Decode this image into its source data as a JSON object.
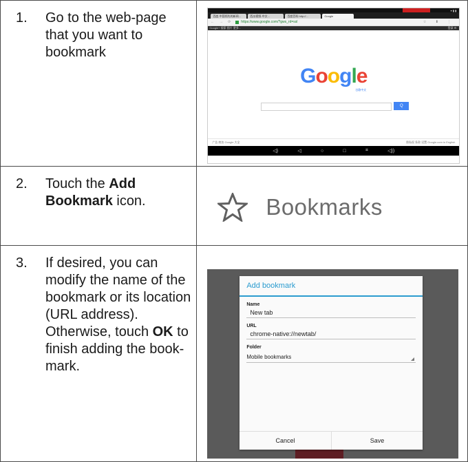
{
  "steps": [
    {
      "number": "1.",
      "text": "Go to the web-page that you want to bookmark"
    },
    {
      "number": "2.",
      "text_before": "Touch the ",
      "bold": "Add Bookmark",
      "text_after": " icon."
    },
    {
      "number": "3.",
      "text_before": "If desired, you can modify the name of the bookmark or its location (URL address). Otherwise, touch ",
      "bold": "OK",
      "text_after": " to finish adding the book-mark."
    }
  ],
  "browser": {
    "tabs": [
      "百度-中国领先的新闻...",
      "西瓜视频-中文...",
      "百度百科 http://...",
      "Google"
    ],
    "url": "https://www.google.com/?gws_rd=ssl",
    "logo_letters": [
      "G",
      "o",
      "o",
      "g",
      "l",
      "e"
    ],
    "logo_sub": "谷歌中文",
    "search_button": "Q",
    "footer_left": "广告   商务   Google 大全",
    "footer_right": "隐私权   条款   设置   Google.com in English",
    "gbar_left": "Google+  搜索  图片  更多 -",
    "gbar_right": "登录  ⚙"
  },
  "bookmarks_zoom": {
    "label": "Bookmarks",
    "icon": "star-outline-icon"
  },
  "dialog": {
    "title": "Add bookmark",
    "name_label": "Name",
    "name_value": "New tab",
    "url_label": "URL",
    "url_value": "chrome-native://newtab/",
    "folder_label": "Folder",
    "folder_value": "Mobile bookmarks",
    "cancel": "Cancel",
    "save": "Save"
  },
  "colors": {
    "accent": "#2a9bcf",
    "google_blue": "#4285f4"
  }
}
